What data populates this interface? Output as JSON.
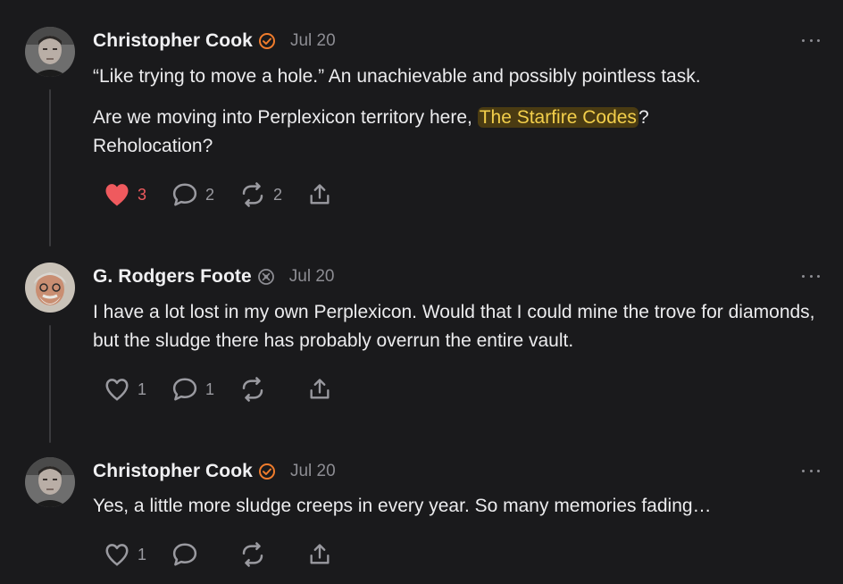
{
  "comments": [
    {
      "author": "Christopher Cook",
      "badge": "verified-orange-badge-icon",
      "date": "Jul 20",
      "paragraphs": [
        {
          "text": "“Like trying to move a hole.” An unachievable and possibly pointless task."
        },
        {
          "before": "Are we moving into Perplexicon territory here, ",
          "mention": "The Starfire Codes",
          "after": "? Reholocation?"
        }
      ],
      "likes": "3",
      "liked": true,
      "replies": "2",
      "restacks": "2"
    },
    {
      "author": "G. Rodgers Foote",
      "badge": "gray-badge-icon",
      "date": "Jul 20",
      "paragraphs": [
        {
          "text": "I have a lot lost in my own Perplexicon. Would that I could mine the trove for diamonds, but the sludge there has probably overrun the entire vault."
        }
      ],
      "likes": "1",
      "liked": false,
      "replies": "1",
      "restacks": ""
    },
    {
      "author": "Christopher Cook",
      "badge": "verified-orange-badge-icon",
      "date": "Jul 20",
      "paragraphs": [
        {
          "text": "Yes, a little more sludge creeps in every year. So many memories fading…"
        }
      ],
      "likes": "1",
      "liked": false,
      "replies": "",
      "restacks": ""
    }
  ],
  "colors": {
    "background": "#1a1a1c",
    "liked": "#ef5a5e",
    "mention_bg": "#4a3b12",
    "mention_text": "#f3cf4b",
    "badge_orange": "#f07c2c"
  }
}
